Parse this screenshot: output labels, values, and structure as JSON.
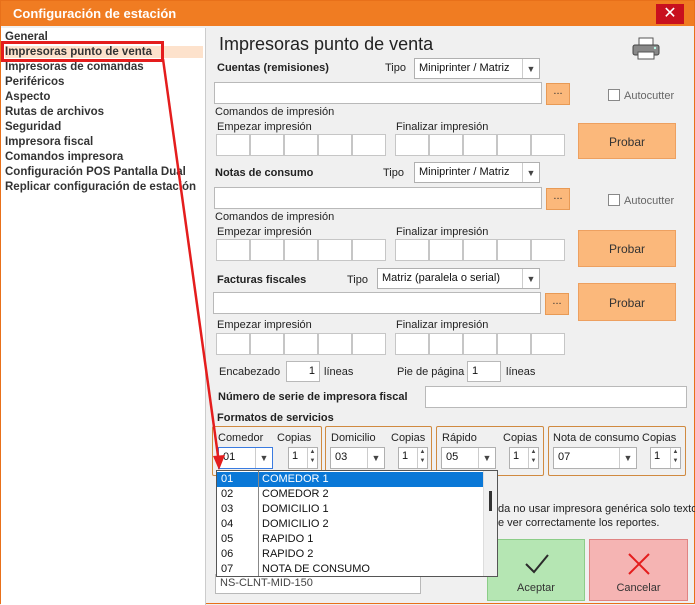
{
  "window": {
    "title": "Configuración de estación",
    "close_glyph": "✕"
  },
  "sidebar": {
    "items": [
      {
        "label": "General"
      },
      {
        "label": "Impresoras punto de venta"
      },
      {
        "label": "Impresoras de comandas"
      },
      {
        "label": "Periféricos"
      },
      {
        "label": "Aspecto"
      },
      {
        "label": "Rutas de archivos"
      },
      {
        "label": "Seguridad"
      },
      {
        "label": "Impresora fiscal"
      },
      {
        "label": "Comandos impresora"
      },
      {
        "label": "Configuración POS Pantalla Dual"
      },
      {
        "label": "Replicar configuración de estación"
      }
    ]
  },
  "main": {
    "heading": "Impresoras punto de venta",
    "cuentas": {
      "label": "Cuentas (remisiones)",
      "tipo_label": "Tipo",
      "tipo_value": "Miniprinter / Matriz",
      "dots": "...",
      "autocutter": "Autocutter",
      "comandos": "Comandos de impresión",
      "empezar": "Empezar impresión",
      "finalizar": "Finalizar impresión",
      "probar": "Probar"
    },
    "notas": {
      "label": "Notas de consumo",
      "tipo_label": "Tipo",
      "tipo_value": "Miniprinter / Matriz",
      "dots": "...",
      "autocutter": "Autocutter",
      "comandos": "Comandos de impresión",
      "empezar": "Empezar impresión",
      "finalizar": "Finalizar impresión",
      "probar": "Probar"
    },
    "facturas": {
      "label": "Facturas fiscales",
      "tipo_label": "Tipo",
      "tipo_value": "Matriz (paralela o serial)",
      "dots": "...",
      "probar": "Probar",
      "empezar": "Empezar impresión",
      "finalizar": "Finalizar impresión",
      "encabezado_label": "Encabezado",
      "encabezado_value": "1",
      "lineas1": "líneas",
      "pie_label": "Pie de página",
      "pie_value": "1",
      "lineas2": "líneas"
    },
    "serie_label": "Número de serie de impresora fiscal",
    "formatos_label": "Formatos de servicios",
    "services": [
      {
        "name": "Comedor",
        "copias_label": "Copias",
        "value": "01",
        "copias": "1"
      },
      {
        "name": "Domicilio",
        "copias_label": "Copias",
        "value": "03",
        "copias": "1"
      },
      {
        "name": "Rápido",
        "copias_label": "Copias",
        "value": "05",
        "copias": "1"
      },
      {
        "name": "Nota de consumo",
        "copias_label": "Copias",
        "value": "07",
        "copias": "1"
      }
    ],
    "dropdown": [
      {
        "code": "01",
        "name": "COMEDOR 1"
      },
      {
        "code": "02",
        "name": "COMEDOR 2"
      },
      {
        "code": "03",
        "name": "DOMICILIO 1"
      },
      {
        "code": "04",
        "name": "DOMICILIO 2"
      },
      {
        "code": "05",
        "name": "RAPIDO 1"
      },
      {
        "code": "06",
        "name": "RAPIDO 2"
      },
      {
        "code": "07",
        "name": "NOTA DE CONSUMO"
      }
    ],
    "hint_line1": "da no usar impresora genérica solo texto",
    "hint_line2": "e ver correctamente los reportes.",
    "station_value": "NS-CLNT-MID-150"
  },
  "buttons": {
    "aceptar": "Aceptar",
    "cancelar": "Cancelar"
  },
  "colors": {
    "accent": "#f07c22",
    "highlight": "#e41d1d",
    "selection": "#0a78d7"
  }
}
